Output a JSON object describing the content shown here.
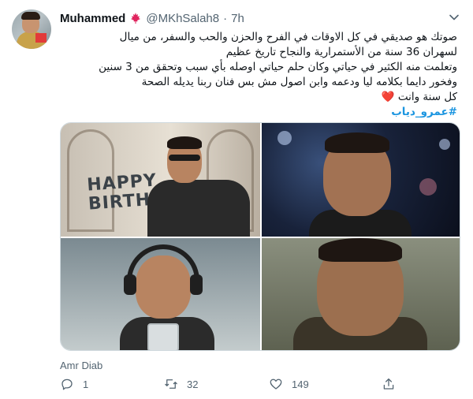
{
  "tweet": {
    "author": {
      "name": "Muhammed",
      "handle": "@MKhSalah8",
      "time_sep": "·",
      "time": "7h",
      "avatar_icon": "profile-avatar",
      "badge_icon": "canada-flag-emoji"
    },
    "text_lines": [
      "صوتك هو صديقي في كل الاوقات في الفرح والحزن والحب والسفر، من ميال",
      "لسهران 36 سنة من الأستمرارية والنجاح تاريخ عظيم",
      "وتعلمت منه الكثير في حياتي وكان حلم حياتي اوصله بأي سبب وتحقق من 3 سنين",
      "وفخور دايما بكلامه ليا ودعمه وابن اصول مش بس فنان ربنا يديله الصحة"
    ],
    "closing_line": "كل سنة وانت",
    "heart": "❤️",
    "hashtag": "#عمرو_دياب",
    "media": {
      "photo1_text": "HAPPY BIRTHDAY AMR",
      "photo_count": 4
    },
    "media_caption": "Amr Diab",
    "actions": {
      "reply_count": "1",
      "retweet_count": "32",
      "like_count": "149"
    }
  },
  "colors": {
    "text_primary": "#0f1419",
    "text_secondary": "#536471",
    "hashtag": "#1b95e0",
    "heart": "#e0245e"
  }
}
